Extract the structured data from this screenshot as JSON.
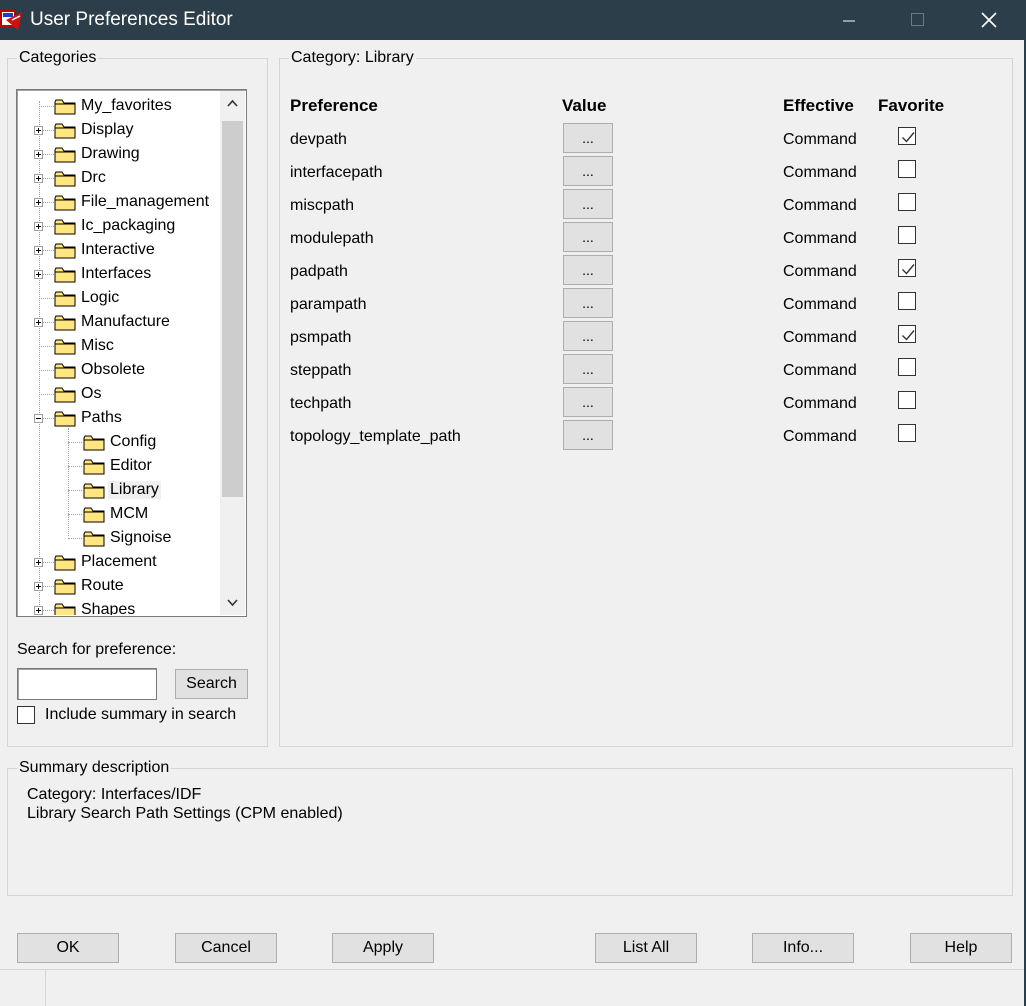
{
  "window": {
    "title": "User Preferences Editor",
    "accent_color": "#2b3e4a"
  },
  "categories": {
    "legend": "Categories",
    "tree": [
      {
        "label": "My_favorites",
        "level": 0,
        "expander": "none"
      },
      {
        "label": "Display",
        "level": 0,
        "expander": "plus"
      },
      {
        "label": "Drawing",
        "level": 0,
        "expander": "plus"
      },
      {
        "label": "Drc",
        "level": 0,
        "expander": "plus"
      },
      {
        "label": "File_management",
        "level": 0,
        "expander": "plus"
      },
      {
        "label": "Ic_packaging",
        "level": 0,
        "expander": "plus"
      },
      {
        "label": "Interactive",
        "level": 0,
        "expander": "plus"
      },
      {
        "label": "Interfaces",
        "level": 0,
        "expander": "plus"
      },
      {
        "label": "Logic",
        "level": 0,
        "expander": "none"
      },
      {
        "label": "Manufacture",
        "level": 0,
        "expander": "plus"
      },
      {
        "label": "Misc",
        "level": 0,
        "expander": "none"
      },
      {
        "label": "Obsolete",
        "level": 0,
        "expander": "none"
      },
      {
        "label": "Os",
        "level": 0,
        "expander": "none"
      },
      {
        "label": "Paths",
        "level": 0,
        "expander": "minus"
      },
      {
        "label": "Config",
        "level": 1,
        "expander": "none"
      },
      {
        "label": "Editor",
        "level": 1,
        "expander": "none"
      },
      {
        "label": "Library",
        "level": 1,
        "expander": "none",
        "selected": true
      },
      {
        "label": "MCM",
        "level": 1,
        "expander": "none"
      },
      {
        "label": "Signoise",
        "level": 1,
        "expander": "none"
      },
      {
        "label": "Placement",
        "level": 0,
        "expander": "plus"
      },
      {
        "label": "Route",
        "level": 0,
        "expander": "plus"
      },
      {
        "label": "Shapes",
        "level": 0,
        "expander": "plus"
      }
    ],
    "search_label": "Search for preference:",
    "search_value": "",
    "search_button": "Search",
    "include_summary_label": "Include summary in search",
    "include_summary_checked": false
  },
  "category_panel": {
    "legend": "Category:  Library",
    "headers": {
      "preference": "Preference",
      "value": "Value",
      "effective": "Effective",
      "favorite": "Favorite"
    },
    "value_button_label": "...",
    "rows": [
      {
        "name": "devpath",
        "effective": "Command",
        "favorite": true
      },
      {
        "name": "interfacepath",
        "effective": "Command",
        "favorite": false
      },
      {
        "name": "miscpath",
        "effective": "Command",
        "favorite": false
      },
      {
        "name": "modulepath",
        "effective": "Command",
        "favorite": false
      },
      {
        "name": "padpath",
        "effective": "Command",
        "favorite": true
      },
      {
        "name": "parampath",
        "effective": "Command",
        "favorite": false
      },
      {
        "name": "psmpath",
        "effective": "Command",
        "favorite": true
      },
      {
        "name": "steppath",
        "effective": "Command",
        "favorite": false
      },
      {
        "name": "techpath",
        "effective": "Command",
        "favorite": false
      },
      {
        "name": "topology_template_path",
        "effective": "Command",
        "favorite": false
      }
    ]
  },
  "summary": {
    "legend": "Summary description",
    "line1": "Category: Interfaces/IDF",
    "line2": "Library Search Path Settings (CPM enabled)"
  },
  "buttons": {
    "ok": "OK",
    "cancel": "Cancel",
    "apply": "Apply",
    "list_all": "List All",
    "info": "Info...",
    "help": "Help"
  },
  "icons": {
    "app": "app-icon",
    "minimize": "minimize-icon",
    "maximize": "maximize-icon",
    "close": "close-icon",
    "folder": "folder-icon",
    "scroll_up": "chevron-up-icon",
    "scroll_down": "chevron-down-icon",
    "check": "check-icon"
  }
}
